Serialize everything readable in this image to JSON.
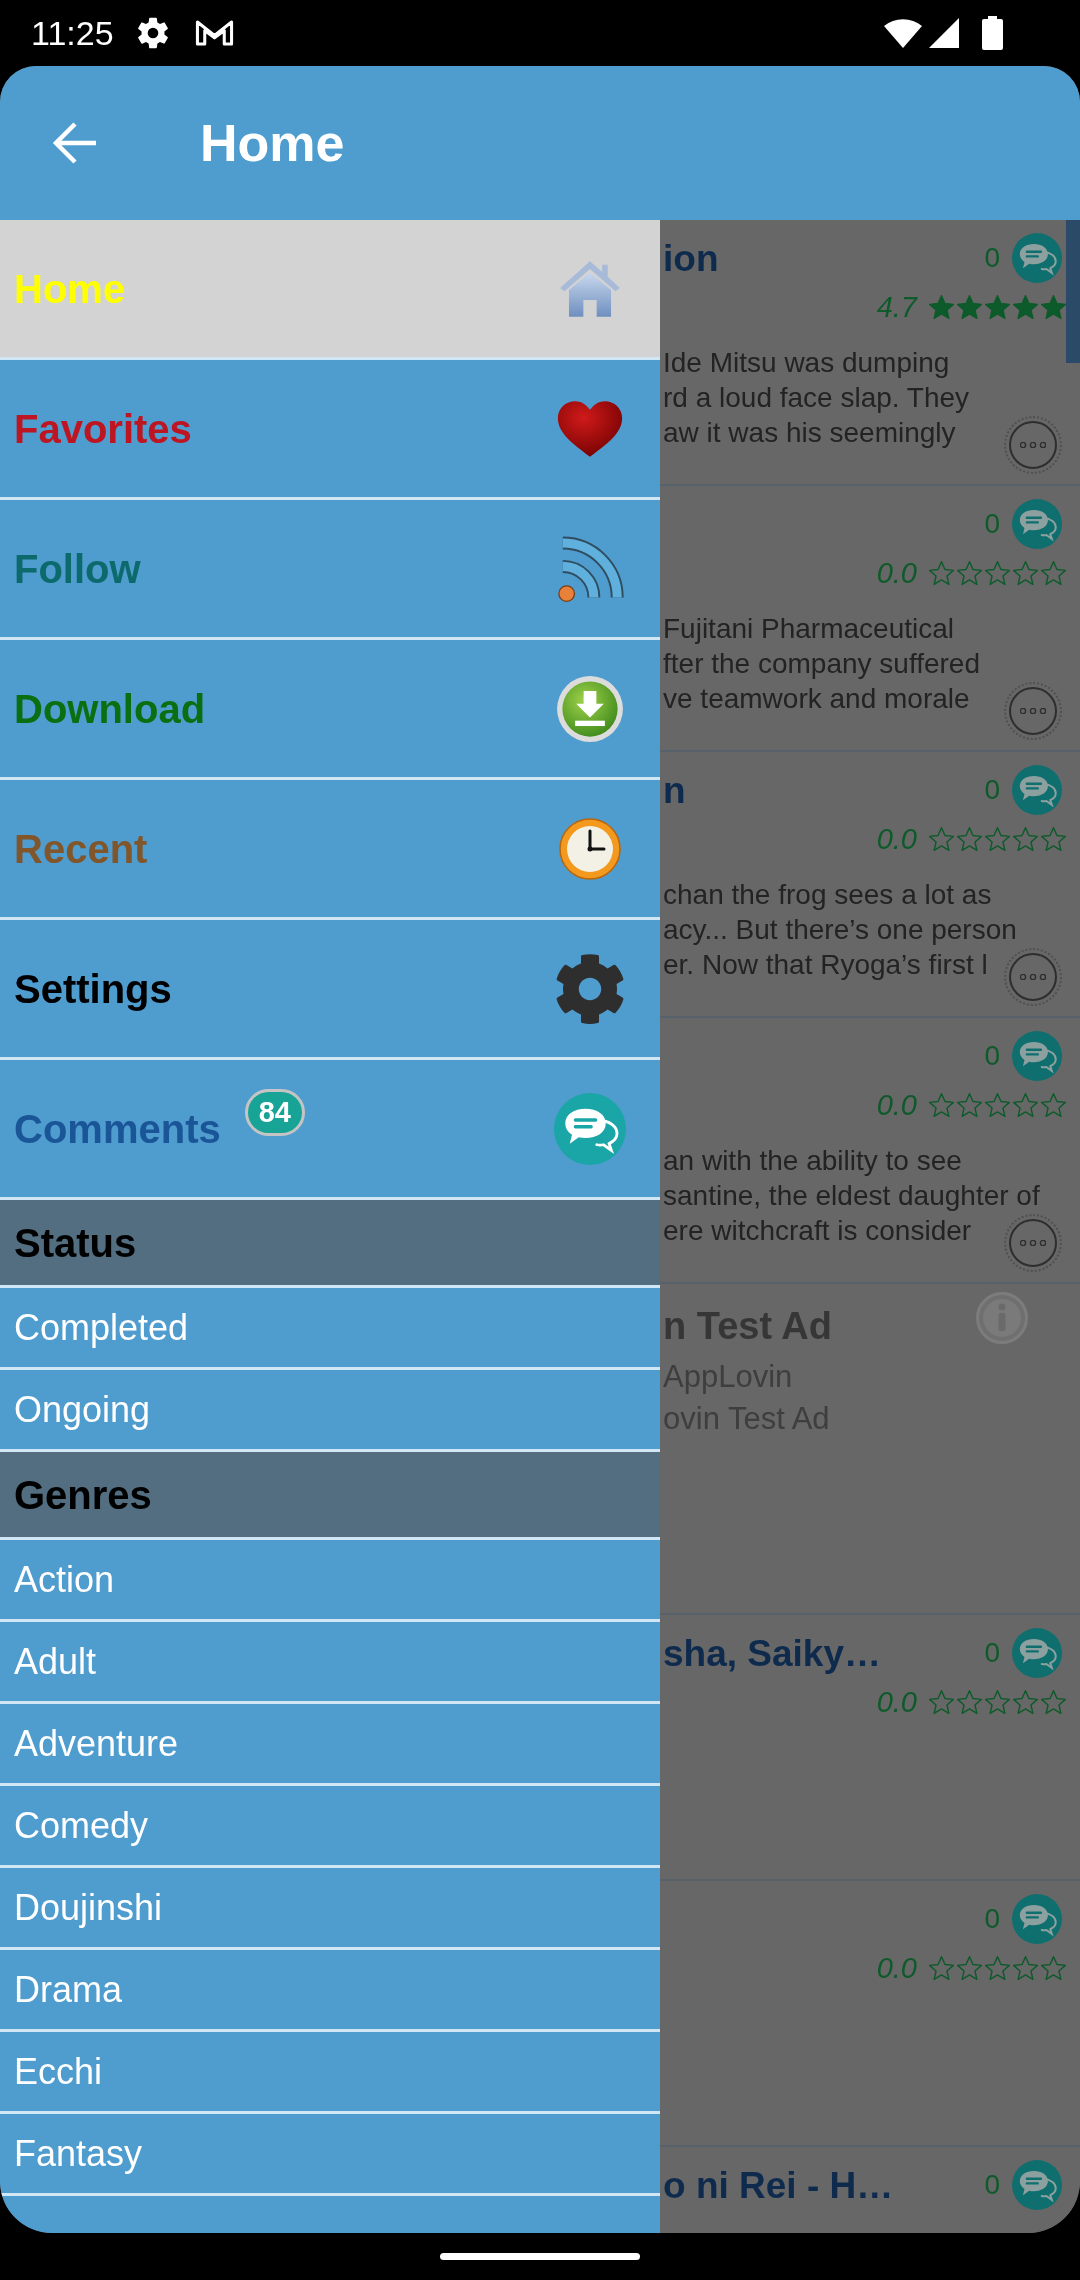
{
  "status_bar": {
    "time": "11:25"
  },
  "app_bar": {
    "title": "Home"
  },
  "drawer": {
    "menu": [
      {
        "label": "Home",
        "color": "#ffff00",
        "selected": true
      },
      {
        "label": "Favorites",
        "color": "#bd1622",
        "selected": false
      },
      {
        "label": "Follow",
        "color": "#0c6a6c",
        "selected": false
      },
      {
        "label": "Download",
        "color": "#087010",
        "selected": false
      },
      {
        "label": "Recent",
        "color": "#80562a",
        "selected": false
      },
      {
        "label": "Settings",
        "color": "#000000",
        "selected": false
      },
      {
        "label": "Comments",
        "color": "#1a5597",
        "selected": false,
        "badge": "84"
      }
    ],
    "sections": [
      {
        "title": "Status",
        "items": [
          "Completed",
          "Ongoing"
        ]
      },
      {
        "title": "Genres",
        "items": [
          "Action",
          "Adult",
          "Adventure",
          "Comedy",
          "Doujinshi",
          "Drama",
          "Ecchi",
          "Fantasy"
        ]
      }
    ]
  },
  "list": [
    {
      "kind": "story",
      "title": "ion",
      "comments": "0",
      "rating": "4.7",
      "stars": 5,
      "description": [
        "Ide Mitsu was dumping",
        "rd a loud face slap. They",
        "aw it was his seemingly"
      ]
    },
    {
      "kind": "story",
      "comments": "0",
      "rating": "0.0",
      "stars": 0,
      "description": [
        "Fujitani Pharmaceutical",
        "fter the company suffered",
        "ve teamwork and morale"
      ]
    },
    {
      "kind": "story",
      "title": "n",
      "comments": "0",
      "rating": "0.0",
      "stars": 0,
      "description": [
        "chan the frog sees a lot as",
        "acy... But there’s one person",
        "er. Now that Ryoga’s first l"
      ]
    },
    {
      "kind": "story",
      "comments": "0",
      "rating": "0.0",
      "stars": 0,
      "description": [
        "an with the ability to see",
        "santine, the eldest daughter of",
        "ere witchcraft is consider"
      ]
    },
    {
      "kind": "ad",
      "title": "n Test Ad",
      "advertiser": "AppLovin",
      "body": "ovin Test Ad"
    },
    {
      "kind": "story",
      "title": "sha, Saiky…",
      "comments": "0",
      "rating": "0.0",
      "stars": 0
    },
    {
      "kind": "story",
      "comments": "0",
      "rating": "0.0",
      "stars": 0
    },
    {
      "kind": "story",
      "title": "o ni Rei - H…",
      "comments": "0"
    }
  ]
}
